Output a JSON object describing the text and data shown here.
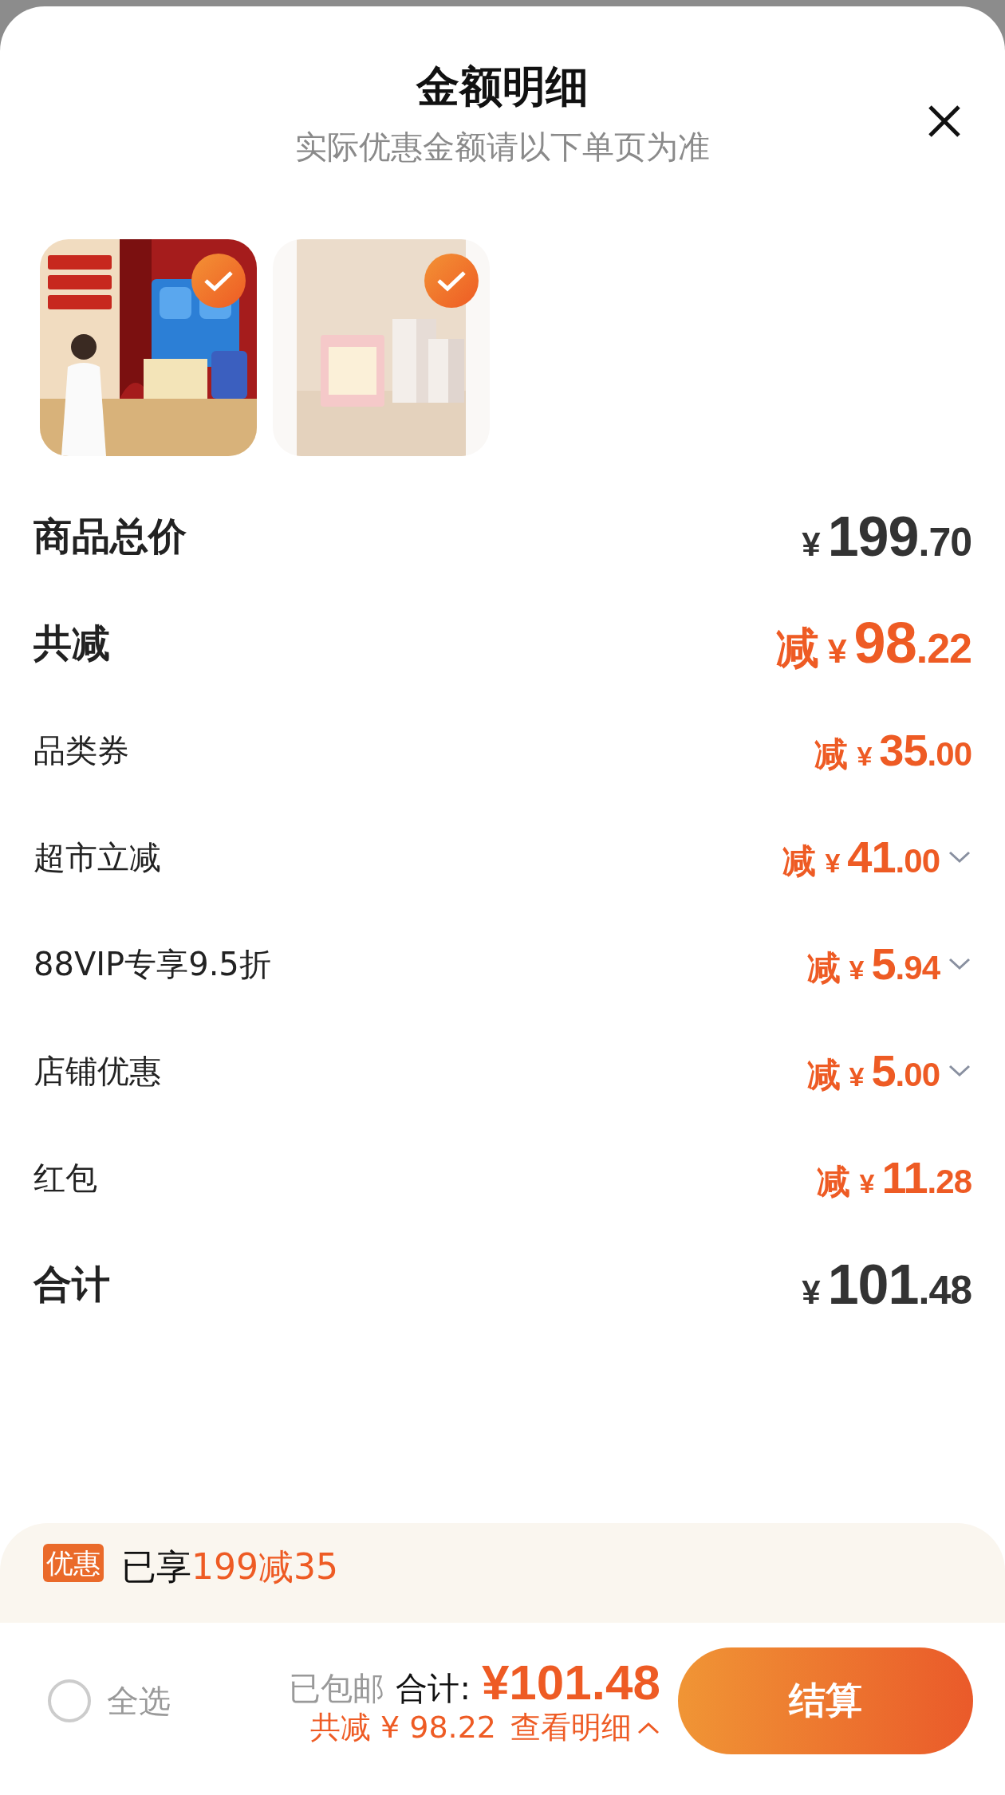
{
  "sheet": {
    "title": "金额明细",
    "subtitle": "实际优惠金额请以下单页为准"
  },
  "products": [
    {
      "kind": "picture",
      "checked": true
    },
    {
      "kind": "picture",
      "checked": true
    }
  ],
  "rows": [
    {
      "label": "商品总价",
      "kind": "total",
      "prefix": "",
      "currency": "¥",
      "integer": "199",
      "decimal": ".70",
      "expandable": false
    },
    {
      "label": "共减",
      "kind": "summary",
      "prefix": "减",
      "currency": "¥",
      "integer": "98",
      "decimal": ".22",
      "expandable": false
    },
    {
      "label": "品类券",
      "kind": "discount",
      "prefix": "减",
      "currency": "¥",
      "integer": "35",
      "decimal": ".00",
      "expandable": false
    },
    {
      "label": "超市立减",
      "kind": "discount",
      "prefix": "减",
      "currency": "¥",
      "integer": "41",
      "decimal": ".00",
      "expandable": true
    },
    {
      "label": "88VIP专享9.5折",
      "kind": "discount",
      "prefix": "减",
      "currency": "¥",
      "integer": "5",
      "decimal": ".94",
      "expandable": true
    },
    {
      "label": "店铺优惠",
      "kind": "discount",
      "prefix": "减",
      "currency": "¥",
      "integer": "5",
      "decimal": ".00",
      "expandable": true
    },
    {
      "label": "红包",
      "kind": "discount",
      "prefix": "减",
      "currency": "¥",
      "integer": "11",
      "decimal": ".28",
      "expandable": false
    },
    {
      "label": "合计",
      "kind": "total",
      "prefix": "",
      "currency": "¥",
      "integer": "101",
      "decimal": ".48",
      "expandable": false
    }
  ],
  "promo": {
    "badge": "优惠",
    "text": "已享",
    "highlight": "199减35"
  },
  "checkout": {
    "select_all": {
      "label": "全选",
      "checked": false
    },
    "shipping": "已包邮",
    "total_label": "合计:",
    "total": "¥101.48",
    "saved": "共减 ¥ 98.22",
    "details_link": "查看明细",
    "details_expanded": true,
    "button": "结算"
  }
}
